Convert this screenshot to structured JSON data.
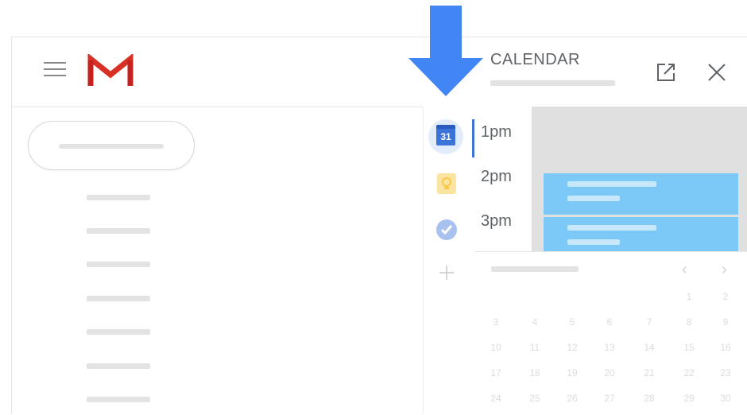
{
  "panel": {
    "title": "CALENDAR",
    "times": [
      "1pm",
      "2pm",
      "3pm"
    ]
  },
  "side_icons": {
    "calendar_day": "31"
  },
  "mini_calendar": {
    "days": [
      [
        "",
        "",
        "",
        "",
        "",
        "1",
        "2"
      ],
      [
        "3",
        "4",
        "5",
        "6",
        "7",
        "8",
        "9"
      ],
      [
        "10",
        "11",
        "12",
        "13",
        "14",
        "15",
        "16"
      ],
      [
        "17",
        "18",
        "19",
        "20",
        "21",
        "22",
        "23"
      ],
      [
        "24",
        "25",
        "26",
        "27",
        "28",
        "29",
        "30"
      ]
    ]
  },
  "colors": {
    "arrow": "#4285f4",
    "event": "#7cc8f6",
    "gmail_red": "#d93025",
    "calendar_blue": "#3b73d9"
  },
  "icons": [
    "menu-icon",
    "gmail-logo",
    "calendar-icon",
    "keep-icon",
    "tasks-icon",
    "add-icon",
    "open-in-new-icon",
    "close-icon",
    "chevron-left-icon",
    "chevron-right-icon",
    "down-arrow"
  ]
}
